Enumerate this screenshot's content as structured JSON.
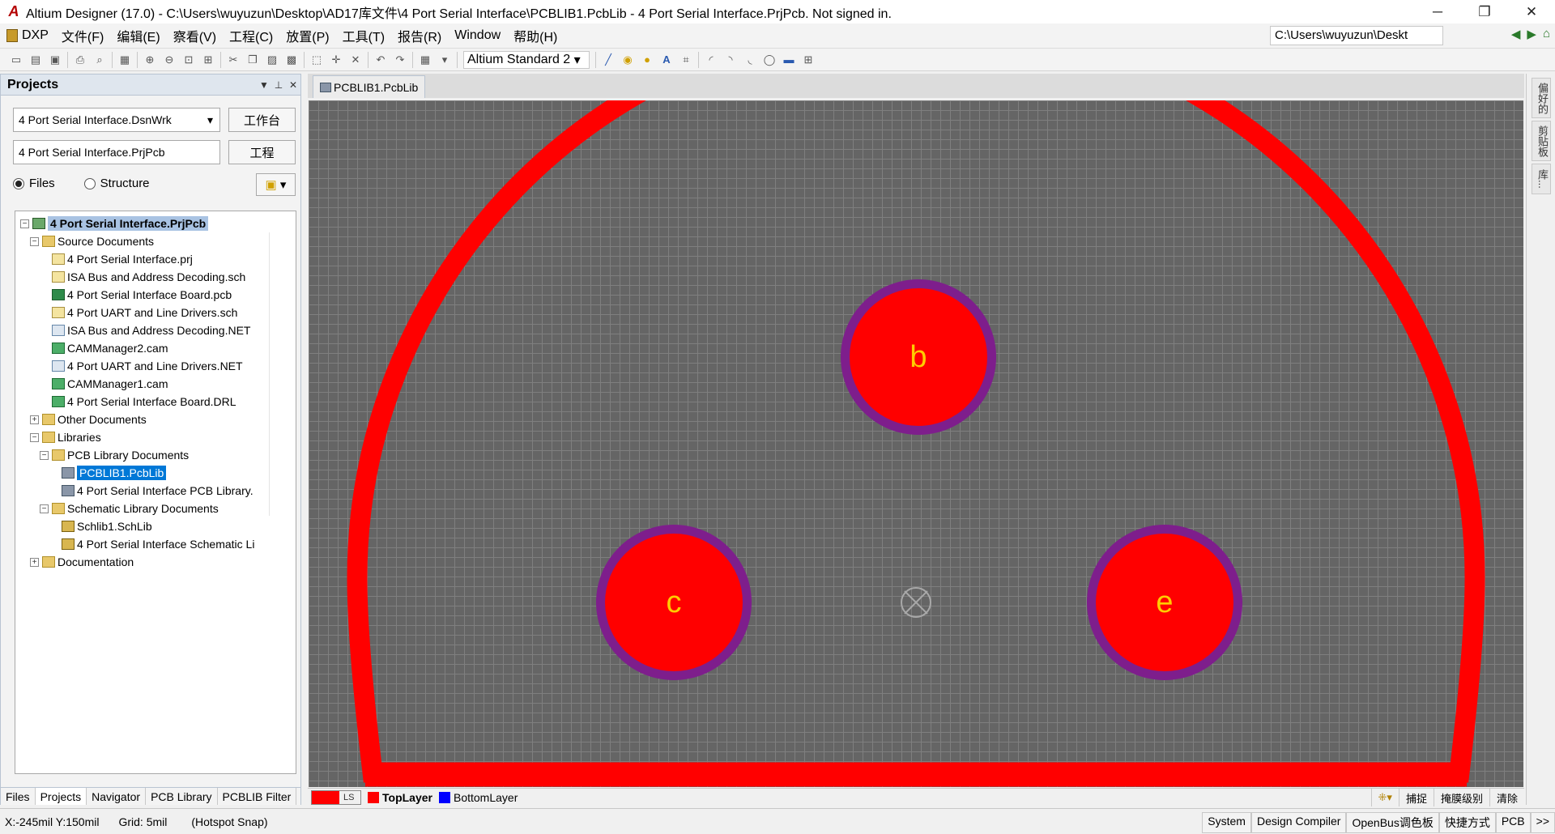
{
  "window": {
    "title": "Altium Designer (17.0) - C:\\Users\\wuyuzun\\Desktop\\AD17库文件\\4 Port Serial Interface\\PCBLIB1.PcbLib - 4 Port Serial Interface.PrjPcb. Not signed in.",
    "minimize": "─",
    "maximize": "❐",
    "close": "✕"
  },
  "menu": {
    "items": [
      "DXP",
      "文件(F)",
      "编辑(E)",
      "察看(V)",
      "工程(C)",
      "放置(P)",
      "工具(T)",
      "报告(R)",
      "Window",
      "帮助(H)"
    ],
    "path": "C:\\Users\\wuyuzun\\Deskt"
  },
  "toolbar": {
    "standard_select": "Altium Standard 2"
  },
  "projects_panel": {
    "title": "Projects",
    "workspace": "4 Port Serial Interface.DsnWrk",
    "workspace_button": "工作台",
    "project": "4 Port Serial Interface.PrjPcb",
    "project_button": "工程",
    "radio_files": "Files",
    "radio_structure": "Structure",
    "tree": [
      {
        "label": "4 Port Serial Interface.PrjPcb",
        "level": 0,
        "type": "project",
        "expander": "−"
      },
      {
        "label": "Source Documents",
        "level": 1,
        "type": "folder",
        "expander": "−"
      },
      {
        "label": "4 Port Serial Interface.prj",
        "level": 2,
        "type": "doc-sch"
      },
      {
        "label": "ISA Bus and Address Decoding.sch",
        "level": 2,
        "type": "doc-sch"
      },
      {
        "label": "4 Port Serial Interface Board.pcb",
        "level": 2,
        "type": "doc-pcb"
      },
      {
        "label": "4 Port UART and Line Drivers.sch",
        "level": 2,
        "type": "doc-sch"
      },
      {
        "label": "ISA Bus and Address Decoding.NET",
        "level": 2,
        "type": "doc-net"
      },
      {
        "label": "CAMManager2.cam",
        "level": 2,
        "type": "doc-cam"
      },
      {
        "label": "4 Port UART and Line Drivers.NET",
        "level": 2,
        "type": "doc-net"
      },
      {
        "label": "CAMManager1.cam",
        "level": 2,
        "type": "doc-cam"
      },
      {
        "label": "4 Port Serial Interface Board.DRL",
        "level": 2,
        "type": "doc-cam"
      },
      {
        "label": "Other Documents",
        "level": 1,
        "type": "folder",
        "expander": "+"
      },
      {
        "label": "Libraries",
        "level": 1,
        "type": "folder",
        "expander": "−"
      },
      {
        "label": "PCB Library Documents",
        "level": 2,
        "type": "folder",
        "expander": "−"
      },
      {
        "label": "PCBLIB1.PcbLib",
        "level": 3,
        "type": "doc-lib",
        "selected": true
      },
      {
        "label": "4 Port Serial Interface PCB Library.",
        "level": 3,
        "type": "doc-lib"
      },
      {
        "label": "Schematic Library Documents",
        "level": 2,
        "type": "folder",
        "expander": "−"
      },
      {
        "label": "Schlib1.SchLib",
        "level": 3,
        "type": "doc-sch-lib"
      },
      {
        "label": "4 Port Serial Interface Schematic Li",
        "level": 3,
        "type": "doc-sch-lib"
      },
      {
        "label": "Documentation",
        "level": 1,
        "type": "folder",
        "expander": "+"
      }
    ],
    "bottom_tabs": [
      "Files",
      "Projects",
      "Navigator",
      "PCB Library",
      "PCBLIB Filter"
    ]
  },
  "document_tab": "PCBLIB1.PcbLib",
  "right_panel_tabs": [
    "偏好的",
    "剪贴板",
    "库..."
  ],
  "pcb": {
    "pads": [
      "b",
      "c",
      "e"
    ],
    "outline_color": "#ff0000",
    "pad_color": "#ff0000",
    "pad_ring_color": "#7e1e8c",
    "pad_label_color": "#ffcc00"
  },
  "layers": {
    "ls_label": "LS",
    "items": [
      {
        "name": "TopLayer",
        "color": "#ff0000"
      },
      {
        "name": "BottomLayer",
        "color": "#0000ff"
      }
    ],
    "right_buttons": [
      "捕捉",
      "掩膜级别",
      "清除"
    ]
  },
  "status": {
    "coords": "X:-245mil Y:150mil",
    "grid": "Grid: 5mil",
    "snap": "(Hotspot Snap)",
    "buttons": [
      "System",
      "Design Compiler",
      "OpenBus调色板",
      "快捷方式",
      "PCB",
      ">>"
    ]
  }
}
